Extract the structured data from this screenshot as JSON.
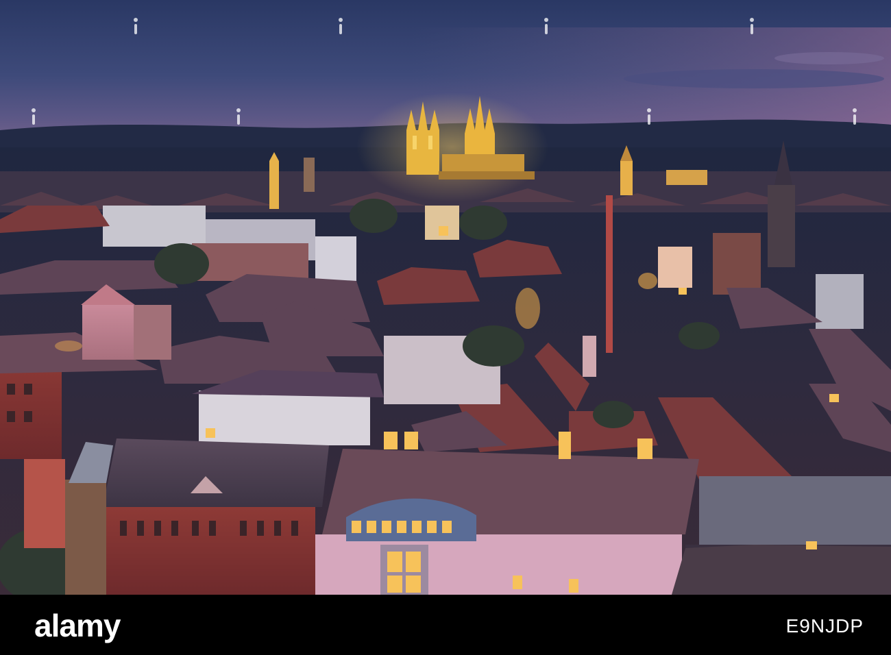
{
  "footer": {
    "brand": "alamy",
    "image_code": "E9NJDP"
  },
  "icons": {
    "watermark": "alamy-figure-watermark-icon"
  },
  "colors": {
    "sky_top": "#2c3a66",
    "sky_horizon": "#6a5f8c",
    "cathedral_light": "#f2c64a",
    "roof_red": "#7a3a3c",
    "window_glow": "#f7c25a",
    "footer_bg": "#000000"
  }
}
